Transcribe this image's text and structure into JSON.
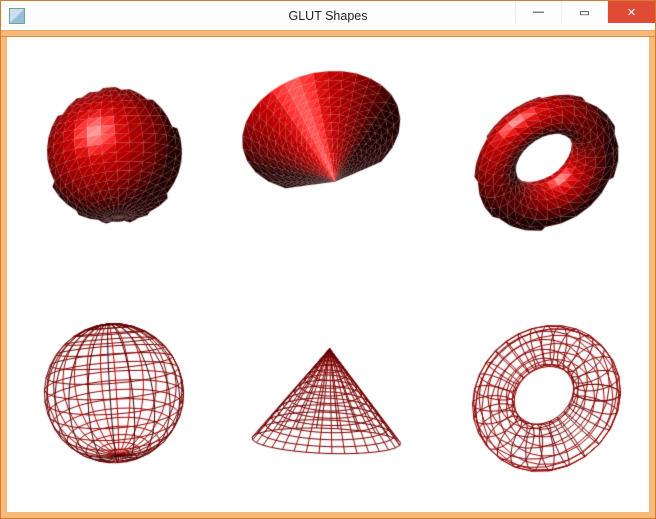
{
  "window": {
    "title": "GLUT Shapes",
    "controls": {
      "minimize_glyph": "—",
      "maximize_glyph": "▭",
      "close_glyph": "✕"
    }
  },
  "scene": {
    "background": "#ffffff",
    "material_color": "#cc0000",
    "shapes": [
      {
        "type": "sphere",
        "style": "solid",
        "row": 0,
        "col": 0
      },
      {
        "type": "cone",
        "style": "solid",
        "row": 0,
        "col": 1
      },
      {
        "type": "torus",
        "style": "solid",
        "row": 0,
        "col": 2
      },
      {
        "type": "sphere",
        "style": "wire",
        "row": 1,
        "col": 0
      },
      {
        "type": "cone",
        "style": "wire",
        "row": 1,
        "col": 1
      },
      {
        "type": "torus",
        "style": "wire",
        "row": 1,
        "col": 2
      }
    ]
  }
}
